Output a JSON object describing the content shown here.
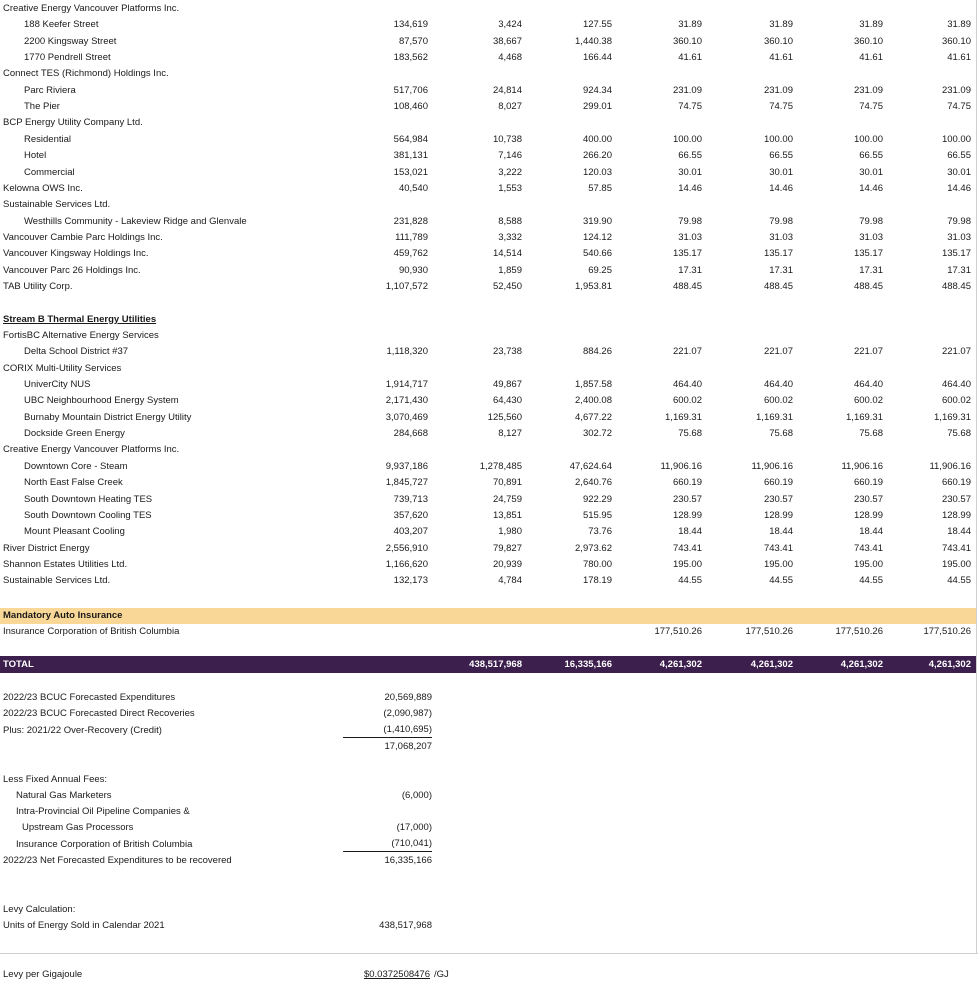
{
  "rows": [
    {
      "label": "Creative Energy Vancouver Platforms Inc.",
      "indent": 0
    },
    {
      "label": "188 Keefer Street",
      "indent": 1,
      "v": [
        "134,619",
        "3,424",
        "127.55",
        "31.89",
        "31.89",
        "31.89",
        "31.89"
      ]
    },
    {
      "label": "2200 Kingsway Street",
      "indent": 1,
      "v": [
        "87,570",
        "38,667",
        "1,440.38",
        "360.10",
        "360.10",
        "360.10",
        "360.10"
      ]
    },
    {
      "label": "1770 Pendrell Street",
      "indent": 1,
      "v": [
        "183,562",
        "4,468",
        "166.44",
        "41.61",
        "41.61",
        "41.61",
        "41.61"
      ]
    },
    {
      "label": "Connect TES (Richmond) Holdings Inc.",
      "indent": 0
    },
    {
      "label": "Parc Riviera",
      "indent": 1,
      "v": [
        "517,706",
        "24,814",
        "924.34",
        "231.09",
        "231.09",
        "231.09",
        "231.09"
      ]
    },
    {
      "label": "The Pier",
      "indent": 1,
      "v": [
        "108,460",
        "8,027",
        "299.01",
        "74.75",
        "74.75",
        "74.75",
        "74.75"
      ]
    },
    {
      "label": "BCP Energy Utility Company Ltd.",
      "indent": 0
    },
    {
      "label": "Residential",
      "indent": 1,
      "v": [
        "564,984",
        "10,738",
        "400.00",
        "100.00",
        "100.00",
        "100.00",
        "100.00"
      ]
    },
    {
      "label": "Hotel",
      "indent": 1,
      "v": [
        "381,131",
        "7,146",
        "266.20",
        "66.55",
        "66.55",
        "66.55",
        "66.55"
      ]
    },
    {
      "label": "Commercial",
      "indent": 1,
      "v": [
        "153,021",
        "3,222",
        "120.03",
        "30.01",
        "30.01",
        "30.01",
        "30.01"
      ]
    },
    {
      "label": "Kelowna OWS Inc.",
      "indent": 0,
      "v": [
        "40,540",
        "1,553",
        "57.85",
        "14.46",
        "14.46",
        "14.46",
        "14.46"
      ]
    },
    {
      "label": "Sustainable Services Ltd.",
      "indent": 0
    },
    {
      "label": "Westhills Community - Lakeview Ridge and Glenvale",
      "indent": 1,
      "v": [
        "231,828",
        "8,588",
        "319.90",
        "79.98",
        "79.98",
        "79.98",
        "79.98"
      ]
    },
    {
      "label": "Vancouver Cambie Parc Holdings Inc.",
      "indent": 0,
      "v": [
        "111,789",
        "3,332",
        "124.12",
        "31.03",
        "31.03",
        "31.03",
        "31.03"
      ]
    },
    {
      "label": "Vancouver Kingsway Holdings Inc.",
      "indent": 0,
      "v": [
        "459,762",
        "14,514",
        "540.66",
        "135.17",
        "135.17",
        "135.17",
        "135.17"
      ]
    },
    {
      "label": "Vancouver Parc 26 Holdings Inc.",
      "indent": 0,
      "v": [
        "90,930",
        "1,859",
        "69.25",
        "17.31",
        "17.31",
        "17.31",
        "17.31"
      ]
    },
    {
      "label": "TAB Utility Corp.",
      "indent": 0,
      "v": [
        "1,107,572",
        "52,450",
        "1,953.81",
        "488.45",
        "488.45",
        "488.45",
        "488.45"
      ]
    },
    {
      "label": "",
      "indent": 0
    },
    {
      "label": "Stream B Thermal Energy Utilities",
      "indent": 0,
      "section": true
    },
    {
      "label": "FortisBC Alternative Energy Services",
      "indent": 0
    },
    {
      "label": "Delta School District #37",
      "indent": 1,
      "v": [
        "1,118,320",
        "23,738",
        "884.26",
        "221.07",
        "221.07",
        "221.07",
        "221.07"
      ]
    },
    {
      "label": "CORIX Multi-Utility Services",
      "indent": 0
    },
    {
      "label": "UniverCity NUS",
      "indent": 1,
      "v": [
        "1,914,717",
        "49,867",
        "1,857.58",
        "464.40",
        "464.40",
        "464.40",
        "464.40"
      ]
    },
    {
      "label": "UBC Neighbourhood Energy System",
      "indent": 1,
      "v": [
        "2,171,430",
        "64,430",
        "2,400.08",
        "600.02",
        "600.02",
        "600.02",
        "600.02"
      ]
    },
    {
      "label": "Burnaby Mountain District Energy Utility",
      "indent": 1,
      "v": [
        "3,070,469",
        "125,560",
        "4,677.22",
        "1,169.31",
        "1,169.31",
        "1,169.31",
        "1,169.31"
      ]
    },
    {
      "label": "Dockside Green Energy",
      "indent": 1,
      "v": [
        "284,668",
        "8,127",
        "302.72",
        "75.68",
        "75.68",
        "75.68",
        "75.68"
      ]
    },
    {
      "label": "Creative Energy Vancouver Platforms Inc.",
      "indent": 0
    },
    {
      "label": "Downtown Core - Steam",
      "indent": 1,
      "v": [
        "9,937,186",
        "1,278,485",
        "47,624.64",
        "11,906.16",
        "11,906.16",
        "11,906.16",
        "11,906.16"
      ]
    },
    {
      "label": "North East False Creek",
      "indent": 1,
      "v": [
        "1,845,727",
        "70,891",
        "2,640.76",
        "660.19",
        "660.19",
        "660.19",
        "660.19"
      ]
    },
    {
      "label": "South Downtown Heating TES",
      "indent": 1,
      "v": [
        "739,713",
        "24,759",
        "922.29",
        "230.57",
        "230.57",
        "230.57",
        "230.57"
      ]
    },
    {
      "label": "South Downtown Cooling TES",
      "indent": 1,
      "v": [
        "357,620",
        "13,851",
        "515.95",
        "128.99",
        "128.99",
        "128.99",
        "128.99"
      ]
    },
    {
      "label": "Mount Pleasant Cooling",
      "indent": 1,
      "v": [
        "403,207",
        "1,980",
        "73.76",
        "18.44",
        "18.44",
        "18.44",
        "18.44"
      ]
    },
    {
      "label": "River District Energy",
      "indent": 0,
      "v": [
        "2,556,910",
        "79,827",
        "2,973.62",
        "743.41",
        "743.41",
        "743.41",
        "743.41"
      ]
    },
    {
      "label": "Shannon Estates Utilities Ltd.",
      "indent": 0,
      "v": [
        "1,166,620",
        "20,939",
        "780.00",
        "195.00",
        "195.00",
        "195.00",
        "195.00"
      ]
    },
    {
      "label": "Sustainable Services Ltd.",
      "indent": 0,
      "v": [
        "132,173",
        "4,784",
        "178.19",
        "44.55",
        "44.55",
        "44.55",
        "44.55"
      ]
    }
  ],
  "mandatory": {
    "heading": "Mandatory Auto Insurance",
    "label": "Insurance Corporation of British Columbia",
    "v": [
      "",
      "",
      "",
      "177,510.26",
      "177,510.26",
      "177,510.26",
      "177,510.26"
    ]
  },
  "total": {
    "label": "TOTAL",
    "v": [
      "",
      "438,517,968",
      "16,335,166",
      "4,261,302",
      "4,261,302",
      "4,261,302",
      "4,261,302"
    ]
  },
  "summary": [
    {
      "label": "2022/23 BCUC Forecasted Expenditures",
      "indent": 0,
      "value": "20,569,889"
    },
    {
      "label": "2022/23 BCUC Forecasted Direct Recoveries",
      "indent": 0,
      "value": "(2,090,987)"
    },
    {
      "label": "Plus: 2021/22 Over-Recovery (Credit)",
      "indent": 0,
      "value": "(1,410,695)",
      "underline": true
    },
    {
      "label": "",
      "indent": 0,
      "value": "17,068,207"
    },
    {
      "label": "",
      "indent": 0,
      "value": ""
    },
    {
      "label": "Less Fixed Annual Fees:",
      "indent": 0,
      "value": ""
    },
    {
      "label": "Natural Gas Marketers",
      "indent": 1,
      "value": "(6,000)"
    },
    {
      "label": "Intra-Provincial Oil Pipeline Companies &",
      "indent": 1,
      "value": ""
    },
    {
      "label": "Upstream Gas Processors",
      "indent": 2,
      "value": "(17,000)"
    },
    {
      "label": "Insurance Corporation of British Columbia",
      "indent": 1,
      "value": "(710,041)",
      "underline": true
    },
    {
      "label": "2022/23 Net Forecasted Expenditures to be recovered",
      "indent": 0,
      "value": "16,335,166"
    },
    {
      "label": "",
      "indent": 0,
      "value": ""
    },
    {
      "label": "",
      "indent": 0,
      "value": ""
    },
    {
      "label": "Levy Calculation:",
      "indent": 0,
      "value": ""
    },
    {
      "label": "Units of Energy Sold in Calendar 2021",
      "indent": 0,
      "value": "438,517,968"
    },
    {
      "label": "",
      "indent": 0,
      "value": ""
    },
    {
      "label": "",
      "indent": 0,
      "value": ""
    },
    {
      "label": "Levy per Gigajoule",
      "indent": 0,
      "value": "$0.0372508476",
      "underline_text": true,
      "unit": "/GJ"
    }
  ]
}
